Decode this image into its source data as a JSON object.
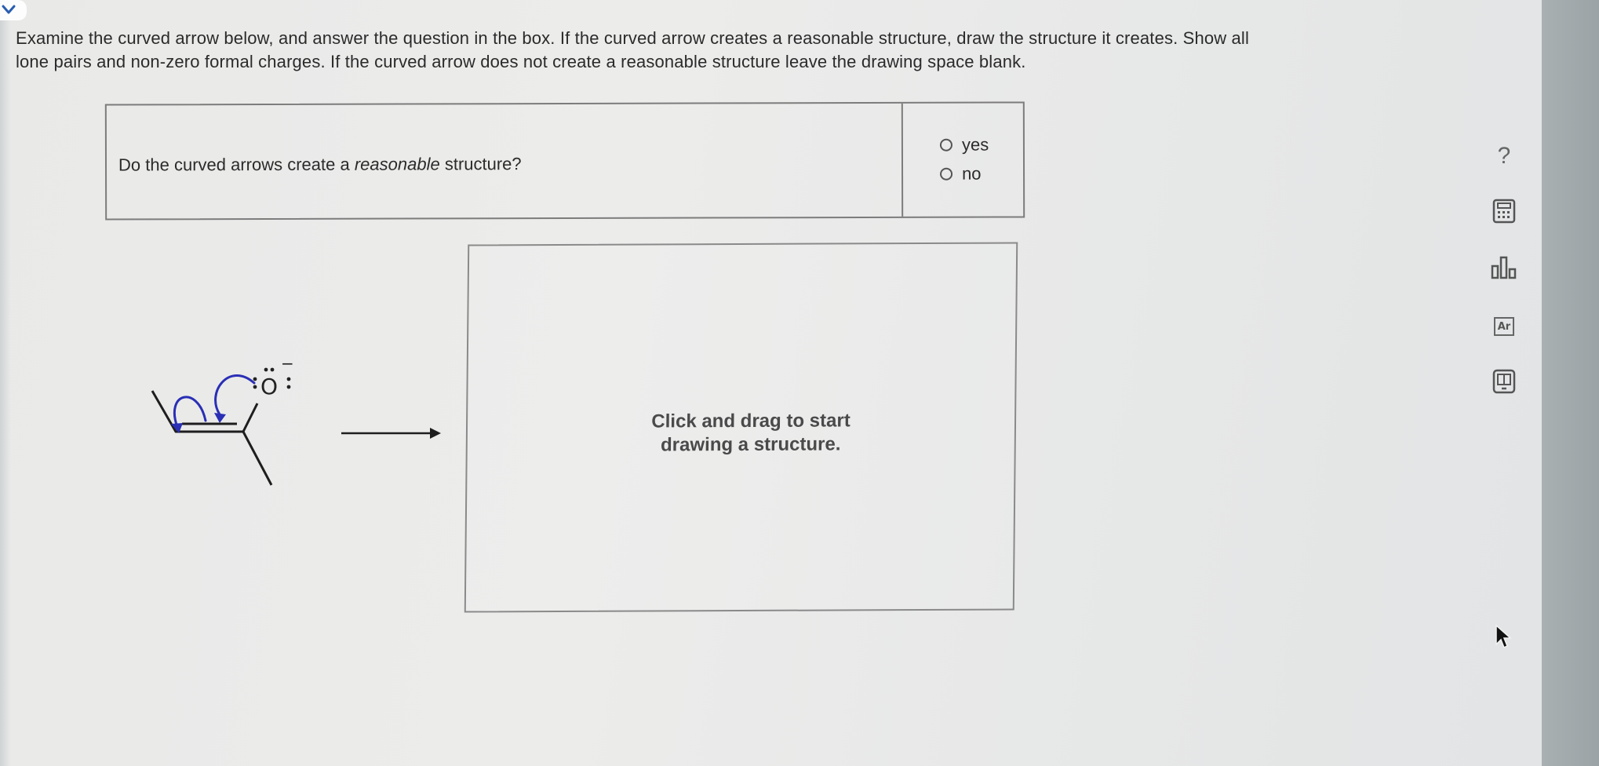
{
  "instructions": {
    "line1": "Examine the curved arrow below, and answer the question in the box. If the curved arrow creates a reasonable structure, draw the structure it creates. Show all",
    "line2": "lone pairs and non-zero formal charges. If the curved arrow does not create a reasonable structure leave the drawing space blank."
  },
  "question": {
    "text_before": "Do the curved arrows create a ",
    "text_emphasis": "reasonable",
    "text_after": " structure?",
    "options": [
      {
        "label": "yes",
        "selected": false
      },
      {
        "label": "no",
        "selected": false
      }
    ]
  },
  "molecule": {
    "atom_label": "O",
    "charge": "−",
    "arrow_color": "#2a2fb5"
  },
  "drawing_area": {
    "prompt_line1": "Click and drag to start",
    "prompt_line2": "drawing a structure."
  },
  "toolbar": {
    "help_label": "?",
    "periodic_label": "Ar",
    "icons": [
      "help-icon",
      "calculator-icon",
      "bar-chart-icon",
      "periodic-table-icon",
      "mobile-icon"
    ]
  },
  "colors": {
    "accent": "#2a5db0",
    "text": "#2b2b2b",
    "border": "#7c7c7c"
  }
}
